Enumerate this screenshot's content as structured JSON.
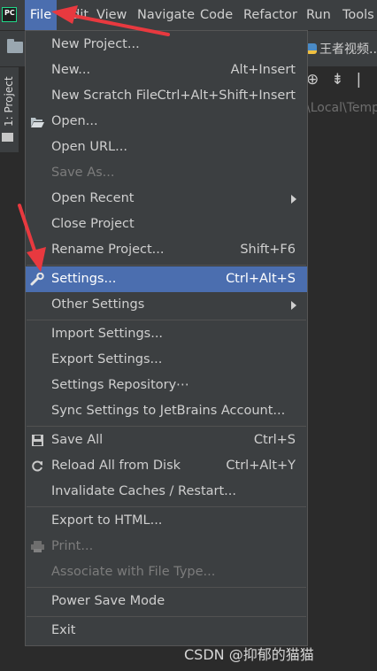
{
  "menubar": {
    "app_icon": "PC",
    "items": [
      "File",
      "Edit",
      "View",
      "Navigate",
      "Code",
      "Refactor",
      "Run",
      "Tools"
    ]
  },
  "side_tab": "1: Project",
  "editor_tab": "王者视频..",
  "path_text": "\\Local\\Temp",
  "file_menu": {
    "items": [
      {
        "label": "New Project...",
        "shortcut": ""
      },
      {
        "label": "New...",
        "shortcut": "Alt+Insert"
      },
      {
        "label": "New Scratch File",
        "shortcut": "Ctrl+Alt+Shift+Insert"
      },
      {
        "label": "Open...",
        "shortcut": "",
        "icon": "folder-open-icon"
      },
      {
        "label": "Open URL...",
        "shortcut": ""
      },
      {
        "label": "Save As...",
        "shortcut": "",
        "disabled": true
      },
      {
        "label": "Open Recent",
        "shortcut": "",
        "submenu": true
      },
      {
        "label": "Close Project",
        "shortcut": ""
      },
      {
        "label": "Rename Project...",
        "shortcut": "Shift+F6"
      },
      {
        "label": "Settings...",
        "shortcut": "Ctrl+Alt+S",
        "icon": "wrench-icon",
        "selected": true
      },
      {
        "label": "Other Settings",
        "shortcut": "",
        "submenu": true
      },
      {
        "label": "Import Settings...",
        "shortcut": ""
      },
      {
        "label": "Export Settings...",
        "shortcut": ""
      },
      {
        "label": "Settings Repository⋯",
        "shortcut": ""
      },
      {
        "label": "Sync Settings to JetBrains Account...",
        "shortcut": ""
      },
      {
        "label": "Save All",
        "shortcut": "Ctrl+S",
        "icon": "save-icon"
      },
      {
        "label": "Reload All from Disk",
        "shortcut": "Ctrl+Alt+Y",
        "icon": "reload-icon"
      },
      {
        "label": "Invalidate Caches / Restart...",
        "shortcut": ""
      },
      {
        "label": "Export to HTML...",
        "shortcut": ""
      },
      {
        "label": "Print...",
        "shortcut": "",
        "disabled": true,
        "icon": "printer-icon"
      },
      {
        "label": "Associate with File Type...",
        "shortcut": "",
        "disabled": true
      },
      {
        "label": "Power Save Mode",
        "shortcut": ""
      },
      {
        "label": "Exit",
        "shortcut": ""
      }
    ]
  },
  "watermark": "CSDN @抑郁的猫猫",
  "colors": {
    "selection": "#4b6eaf",
    "menu_bg": "#3c3f41",
    "arrow": "#e8393f"
  }
}
